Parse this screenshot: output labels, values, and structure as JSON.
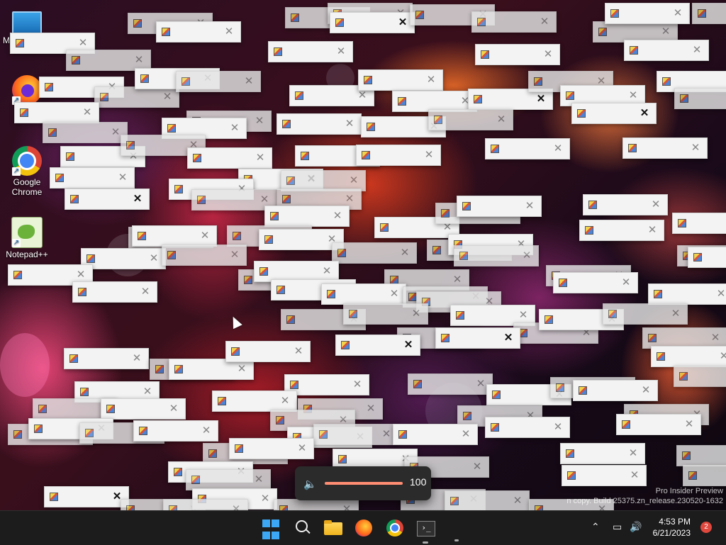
{
  "desktop": {
    "icons": [
      {
        "label": "My"
      },
      {
        "label": ""
      },
      {
        "label": "Google Chrome"
      },
      {
        "label": "Notepad++"
      }
    ],
    "watermark": {
      "line1": "Pro Insider Preview",
      "line2": "n copy. Build 25375.zn_release.230520-1632"
    }
  },
  "error_windows": {
    "close_glyph": "✕",
    "active_close_glyph": "✕",
    "count_visible": "many"
  },
  "volume_flyout": {
    "value": "100",
    "level_percent": 100
  },
  "taskbar": {
    "apps": [
      "Start",
      "Search",
      "File Explorer",
      "Firefox",
      "Google Chrome",
      "Terminal"
    ],
    "tray": {
      "time": "4:53 PM",
      "date": "6/21/2023",
      "notification_count": "2"
    }
  }
}
